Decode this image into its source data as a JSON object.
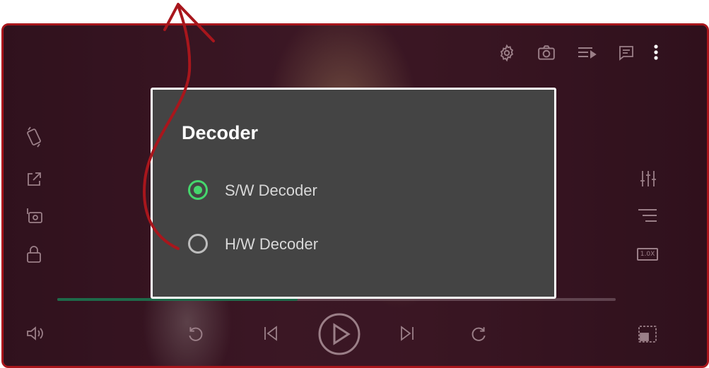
{
  "dialog": {
    "title": "Decoder",
    "options": [
      {
        "label": "S/W Decoder",
        "selected": true
      },
      {
        "label": "H/W Decoder",
        "selected": false
      }
    ]
  },
  "player": {
    "speed_badge": "1.0X",
    "progress": 0.43,
    "top_icons": [
      "settings-icon",
      "camera-icon",
      "playlist-play-icon",
      "subtitle-icon",
      "more-vert-icon"
    ],
    "left_icons": [
      "screen-rotation-icon",
      "open-external-icon",
      "background-play-icon",
      "lock-icon"
    ],
    "right_icons": [
      "equalizer-icon",
      "playlist-icon",
      "playback-speed-icon"
    ],
    "bottom_icons": [
      "volume-icon",
      "replay-icon",
      "skip-previous-icon",
      "play-icon",
      "skip-next-icon",
      "forward-icon",
      "picture-in-picture-icon"
    ]
  },
  "colors": {
    "accent": "#45d66c",
    "annotation": "#a8161c",
    "dialog_bg": "#444444"
  }
}
